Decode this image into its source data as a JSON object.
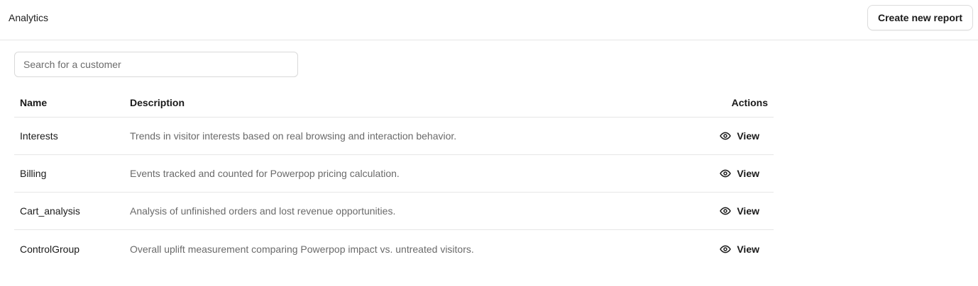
{
  "header": {
    "title": "Analytics",
    "create_button_label": "Create new report"
  },
  "search": {
    "placeholder": "Search for a customer",
    "value": ""
  },
  "table": {
    "columns": {
      "name": "Name",
      "description": "Description",
      "actions": "Actions"
    },
    "rows": [
      {
        "name": "Interests",
        "description": "Trends in visitor interests based on real browsing and interaction behavior.",
        "action_label": "View",
        "action_icon": "eye-icon"
      },
      {
        "name": "Billing",
        "description": "Events tracked and counted for Powerpop pricing calculation.",
        "action_label": "View",
        "action_icon": "eye-icon"
      },
      {
        "name": "Cart_analysis",
        "description": "Analysis of unfinished orders and lost revenue opportunities.",
        "action_label": "View",
        "action_icon": "eye-icon"
      },
      {
        "name": "ControlGroup",
        "description": "Overall uplift measurement comparing Powerpop impact vs. untreated visitors.",
        "action_label": "View",
        "action_icon": "eye-icon"
      }
    ]
  }
}
